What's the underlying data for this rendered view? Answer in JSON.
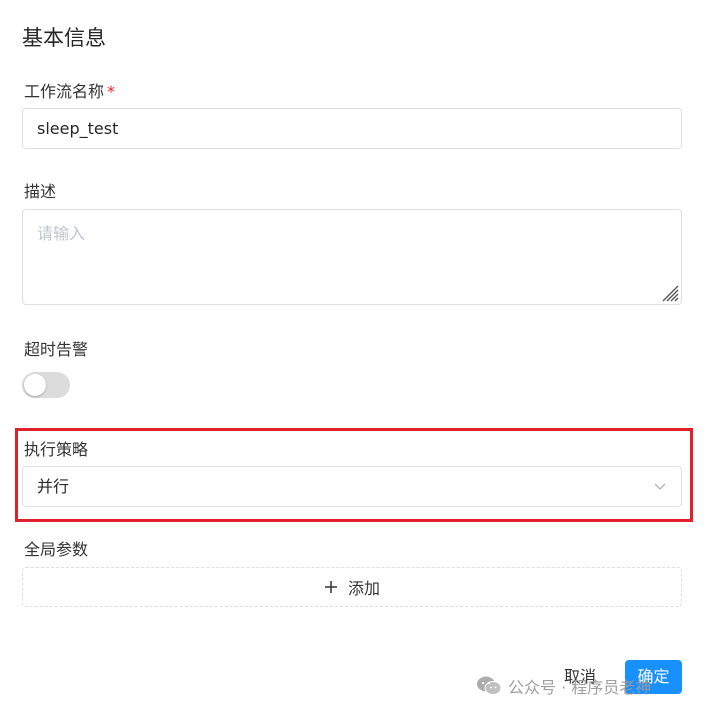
{
  "form": {
    "section_title": "基本信息",
    "workflow_name": {
      "label": "工作流名称",
      "required_mark": "*",
      "value": "sleep_test"
    },
    "description": {
      "label": "描述",
      "placeholder": "请输入",
      "value": ""
    },
    "timeout_alert": {
      "label": "超时告警",
      "enabled": false
    },
    "execution_strategy": {
      "label": "执行策略",
      "selected": "并行"
    },
    "global_params": {
      "label": "全局参数",
      "add_label": "添加"
    }
  },
  "footer": {
    "cancel_label": "取消",
    "confirm_label": "确定"
  },
  "watermark": {
    "text": "公众号 · 程序员老神"
  },
  "colors": {
    "primary": "#1890ff",
    "highlight": "#e0202a",
    "required": "#f5222d"
  }
}
